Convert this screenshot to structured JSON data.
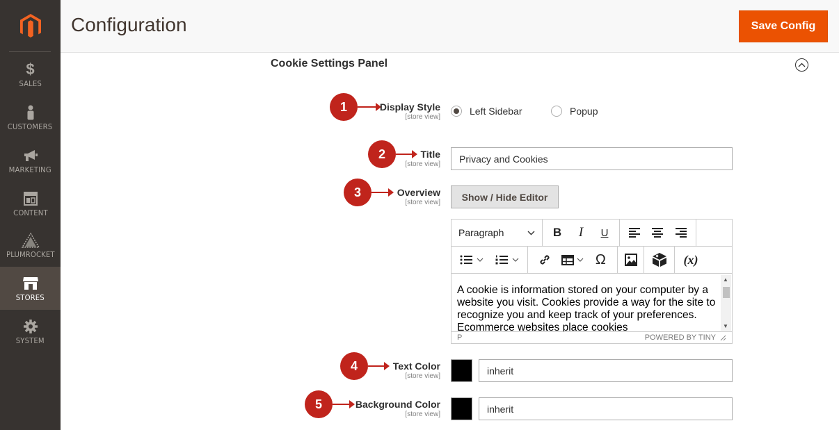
{
  "header": {
    "title": "Configuration",
    "save_label": "Save Config"
  },
  "sidebar": {
    "items": [
      {
        "label": "SALES",
        "icon": "dollar-icon"
      },
      {
        "label": "CUSTOMERS",
        "icon": "customers-icon"
      },
      {
        "label": "MARKETING",
        "icon": "megaphone-icon"
      },
      {
        "label": "CONTENT",
        "icon": "content-icon"
      },
      {
        "label": "PLUMROCKET",
        "icon": "plumrocket-icon"
      },
      {
        "label": "STORES",
        "icon": "stores-icon",
        "active": true
      },
      {
        "label": "SYSTEM",
        "icon": "gear-icon"
      }
    ]
  },
  "section": {
    "title": "Cookie Settings Panel"
  },
  "fields": {
    "display_style": {
      "label": "Display Style",
      "scope": "[store view]",
      "options": [
        "Left Sidebar",
        "Popup"
      ],
      "selected": "Left Sidebar"
    },
    "title": {
      "label": "Title",
      "scope": "[store view]",
      "value": "Privacy and Cookies"
    },
    "overview": {
      "label": "Overview",
      "scope": "[store view]",
      "button": "Show / Hide Editor"
    },
    "text_color": {
      "label": "Text Color",
      "scope": "[store view]",
      "value": "inherit",
      "swatch": "#000000"
    },
    "background_color": {
      "label": "Background Color",
      "scope": "[store view]",
      "value": "inherit",
      "swatch": "#000000"
    }
  },
  "editor": {
    "format": "Paragraph",
    "content": "A cookie is information stored on your computer by a website you visit. Cookies provide a way for the site to recognize you and keep track of your preferences. Ecommerce websites place cookies",
    "path": "P",
    "powered": "POWERED BY TINY"
  },
  "markers": [
    "1",
    "2",
    "3",
    "4",
    "5"
  ],
  "colors": {
    "accent": "#eb5202",
    "marker": "#c0241c",
    "sidebar": "#373330"
  }
}
